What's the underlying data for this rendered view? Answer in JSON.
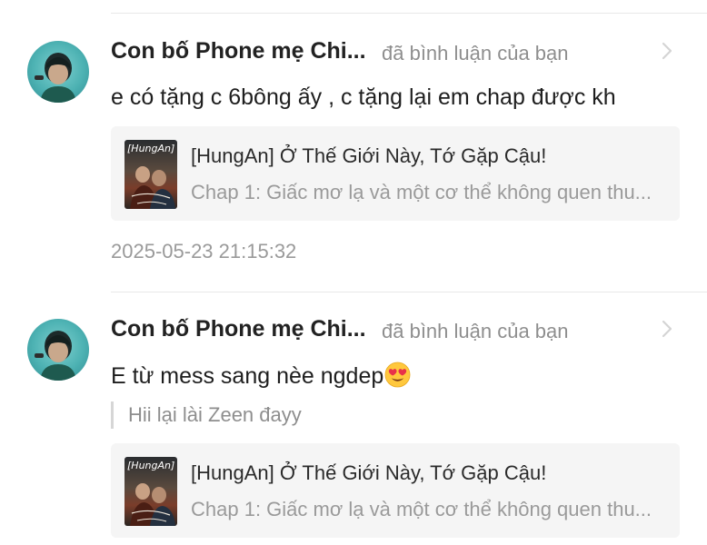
{
  "notifications": [
    {
      "user_name": "Con bố Phone mẹ Chi...",
      "action": "đã bình luận của bạn",
      "comment": "e có tặng c 6bông ấy , c tặng lại em chap được kh",
      "quote": "",
      "card": {
        "title": "[HungAn] Ở Thế Giới Này, Tớ Gặp Cậu!",
        "subtitle": "Chap 1: Giấc mơ lạ và một cơ thể không quen thu...",
        "thumb_text": "[HungAn]"
      },
      "timestamp": "2025-05-23 21:15:32"
    },
    {
      "user_name": "Con bố Phone mẹ Chi...",
      "action": "đã bình luận của bạn",
      "comment": "E từ mess sang nèe ngdep",
      "comment_emoji": "heart-eyes-emoji",
      "quote": "Hii lại lài Zeen đayy",
      "card": {
        "title": "[HungAn] Ở Thế Giới Này, Tớ Gặp Cậu!",
        "subtitle": "Chap 1: Giấc mơ lạ và một cơ thể không quen thu...",
        "thumb_text": "[HungAn]"
      },
      "timestamp": ""
    }
  ],
  "icons": {
    "chevron": "chevron-right-icon",
    "emoji": "heart-eyes-emoji"
  },
  "colors": {
    "name": "#222222",
    "secondary_text": "#8e8e8e",
    "card_background": "#f5f5f5",
    "divider": "#e8e8e8"
  }
}
